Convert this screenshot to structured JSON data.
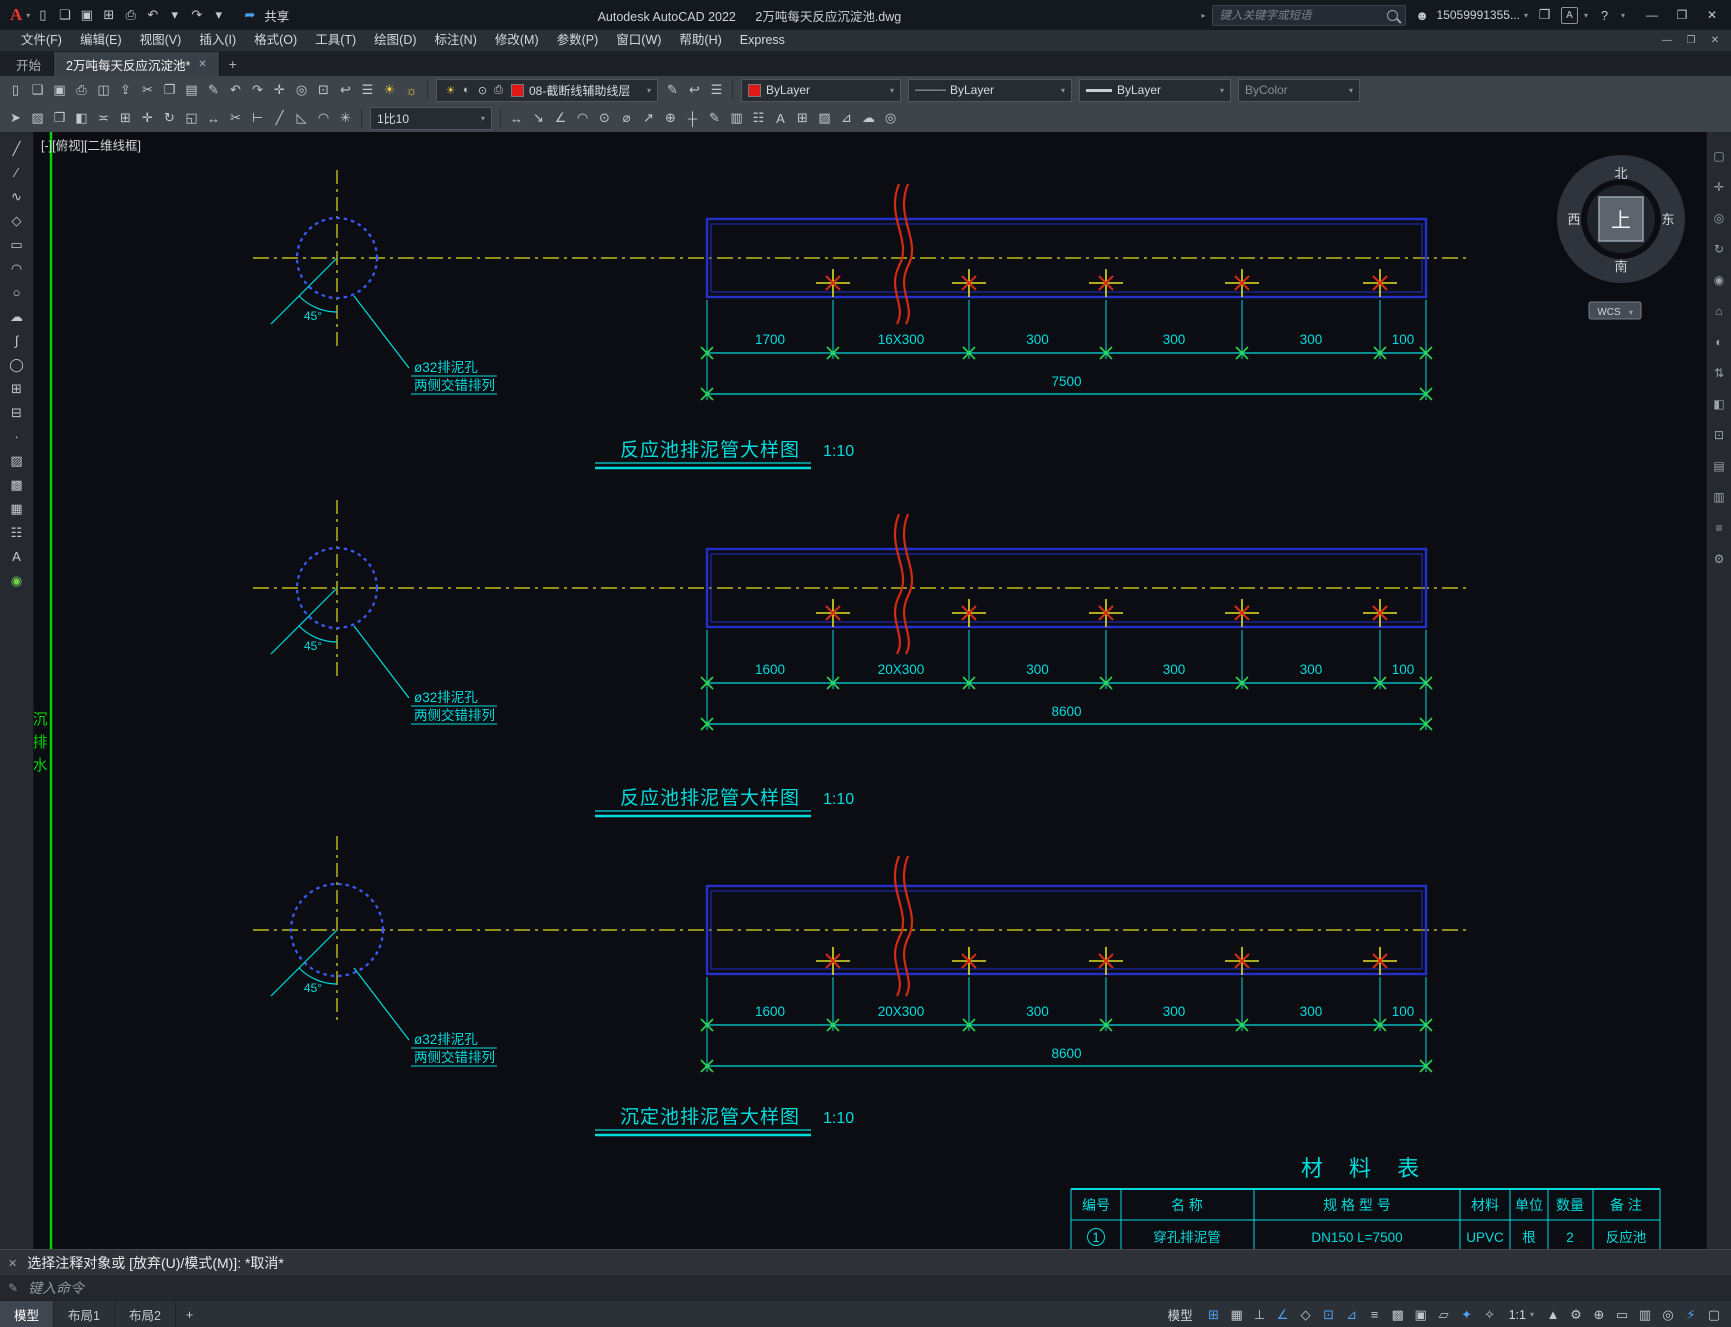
{
  "colors": {
    "cyan": "#00dcdc",
    "yellow": "#e4de1e",
    "blue": "#2330cc",
    "blue_bright": "#3d5bff",
    "red": "#d42a14",
    "green": "#00d400",
    "green2": "#2bd84e",
    "label": "#d2d6da"
  },
  "titlebar": {
    "app_title": "Autodesk AutoCAD 2022",
    "doc_title": "2万吨每天反应沉淀池.dwg",
    "share": "共享",
    "search_placeholder": "键入关键字或短语",
    "user": "15059991355...",
    "qat_icons": [
      {
        "n": "new-file",
        "g": "▯"
      },
      {
        "n": "open-file",
        "g": "❏"
      },
      {
        "n": "save",
        "g": "▣"
      },
      {
        "n": "save-as",
        "g": "⊞"
      },
      {
        "n": "plot",
        "g": "⎙"
      },
      {
        "n": "undo",
        "g": "↶"
      },
      {
        "n": "undo-caret",
        "g": "▾"
      },
      {
        "n": "redo",
        "g": "↷"
      },
      {
        "n": "redo-caret",
        "g": "▾"
      }
    ]
  },
  "menubar": {
    "items": [
      "文件(F)",
      "编辑(E)",
      "视图(V)",
      "插入(I)",
      "格式(O)",
      "工具(T)",
      "绘图(D)",
      "标注(N)",
      "修改(M)",
      "参数(P)",
      "窗口(W)",
      "帮助(H)",
      "Express"
    ]
  },
  "tabbar": {
    "start_tab": "开始",
    "doc_tab": "2万吨每天反应沉淀池*"
  },
  "toolbar1": {
    "icons_a": [
      {
        "n": "new-file",
        "g": "▯"
      },
      {
        "n": "open-file",
        "g": "❏"
      },
      {
        "n": "save",
        "g": "▣"
      },
      {
        "n": "plot",
        "g": "⎙"
      },
      {
        "n": "plot-preview",
        "g": "◫"
      },
      {
        "n": "publish",
        "g": "⇪"
      },
      {
        "n": "cut",
        "g": "✂"
      },
      {
        "n": "copy",
        "g": "❐"
      },
      {
        "n": "paste",
        "g": "▤"
      },
      {
        "n": "match-properties",
        "g": "✎"
      },
      {
        "n": "undo",
        "g": "↶"
      },
      {
        "n": "redo",
        "g": "↷"
      },
      {
        "n": "pan",
        "g": "✛"
      },
      {
        "n": "zoom-realtime",
        "g": "◎"
      },
      {
        "n": "zoom-window",
        "g": "⊡"
      },
      {
        "n": "zoom-previous",
        "g": "↩"
      },
      {
        "n": "layer-properties",
        "g": "☰"
      },
      {
        "n": "layer-on",
        "g": "☀",
        "c": "yellow"
      },
      {
        "n": "layer-freeze",
        "g": "☼",
        "c": "yellow"
      }
    ],
    "layer_status_icons": [
      {
        "n": "layer-visible",
        "g": "☀",
        "c": "yellow"
      },
      {
        "n": "layer-freeze",
        "g": "◐"
      },
      {
        "n": "layer-lock",
        "g": "⊙"
      },
      {
        "n": "layer-plot",
        "g": "⎙"
      }
    ],
    "layer_value": "08-截断线辅助线层",
    "icons_b": [
      {
        "n": "layer-match",
        "g": "✎"
      },
      {
        "n": "layer-previous",
        "g": "↩"
      },
      {
        "n": "layer-states",
        "g": "☰"
      }
    ],
    "color_value": "ByLayer",
    "linetype_value": "ByLayer",
    "lineweight_value": "ByLayer",
    "plotstyle_value": "ByColor"
  },
  "toolbar2": {
    "icons_a": [
      {
        "n": "select",
        "g": "➤"
      },
      {
        "n": "erase",
        "g": "▨"
      },
      {
        "n": "copy-object",
        "g": "❒"
      },
      {
        "n": "mirror",
        "g": "◧"
      },
      {
        "n": "offset",
        "g": "≍"
      },
      {
        "n": "array",
        "g": "⊞"
      },
      {
        "n": "move",
        "g": "✛"
      },
      {
        "n": "rotate",
        "g": "↻"
      },
      {
        "n": "scale",
        "g": "◱"
      },
      {
        "n": "stretch",
        "g": "↔"
      },
      {
        "n": "trim",
        "g": "✂"
      },
      {
        "n": "extend",
        "g": "⊢"
      },
      {
        "n": "break",
        "g": "╱"
      },
      {
        "n": "chamfer",
        "g": "◺"
      },
      {
        "n": "fillet",
        "g": "◠"
      },
      {
        "n": "explode",
        "g": "✳"
      }
    ],
    "scale_value": "1比10",
    "icons_b": [
      {
        "n": "dim-linear",
        "g": "↔"
      },
      {
        "n": "dim-aligned",
        "g": "↘"
      },
      {
        "n": "dim-angular",
        "g": "∠"
      },
      {
        "n": "dim-arc",
        "g": "◠"
      },
      {
        "n": "dim-radius",
        "g": "⊙"
      },
      {
        "n": "dim-diameter",
        "g": "⌀"
      },
      {
        "n": "leader",
        "g": "↗"
      },
      {
        "n": "tolerance",
        "g": "⊕"
      },
      {
        "n": "center-mark",
        "g": "┼"
      },
      {
        "n": "dim-edit",
        "g": "✎"
      },
      {
        "n": "dim-style",
        "g": "▥"
      },
      {
        "n": "table",
        "g": "☷"
      },
      {
        "n": "mtext",
        "g": "A"
      },
      {
        "n": "block",
        "g": "⊞"
      },
      {
        "n": "hatch",
        "g": "▨"
      },
      {
        "n": "measure",
        "g": "⊿"
      },
      {
        "n": "revision-cloud",
        "g": "☁"
      },
      {
        "n": "osnap-settings",
        "g": "◎"
      }
    ]
  },
  "left_toolbar": {
    "icons": [
      {
        "n": "line",
        "g": "╱"
      },
      {
        "n": "construction-line",
        "g": "∕"
      },
      {
        "n": "polyline",
        "g": "∿"
      },
      {
        "n": "polygon",
        "g": "◇"
      },
      {
        "n": "rectangle",
        "g": "▭"
      },
      {
        "n": "arc",
        "g": "◠"
      },
      {
        "n": "circle",
        "g": "○"
      },
      {
        "n": "revision-cloud",
        "g": "☁"
      },
      {
        "n": "spline",
        "g": "∫"
      },
      {
        "n": "ellipse",
        "g": "◯"
      },
      {
        "n": "insert-block",
        "g": "⊞"
      },
      {
        "n": "create-block",
        "g": "⊟"
      },
      {
        "n": "point",
        "g": "∙"
      },
      {
        "n": "hatch",
        "g": "▨"
      },
      {
        "n": "gradient",
        "g": "▩"
      },
      {
        "n": "region",
        "g": "▦"
      },
      {
        "n": "table",
        "g": "☷"
      },
      {
        "n": "text",
        "g": "A"
      },
      {
        "n": "color-ball",
        "g": "◉",
        "c": "green"
      }
    ]
  },
  "right_toolbar": {
    "icons": [
      {
        "n": "fullscreen",
        "g": "▢"
      },
      {
        "n": "pan",
        "g": "✛"
      },
      {
        "n": "zoom",
        "g": "◎"
      },
      {
        "n": "orbit",
        "g": "↻"
      },
      {
        "n": "steering-wheel",
        "g": "◉"
      },
      {
        "n": "home-view",
        "g": "⌂"
      },
      {
        "n": "look",
        "g": "◐"
      },
      {
        "n": "walk",
        "g": "⇅"
      },
      {
        "n": "section",
        "g": "◧"
      },
      {
        "n": "object-snap",
        "g": "⊡"
      },
      {
        "n": "layers-panel",
        "g": "▤"
      },
      {
        "n": "properties-panel",
        "g": "▥"
      },
      {
        "n": "list",
        "g": "≡"
      },
      {
        "n": "settings",
        "g": "⚙"
      }
    ]
  },
  "canvas": {
    "viewport_label": "[-][俯视][二维线框]",
    "left_margin_text": [
      "沉",
      "排",
      "水"
    ],
    "compass": {
      "north": "北",
      "south": "南",
      "east": "东",
      "west": "西",
      "top": "上",
      "wcs": "WCS"
    }
  },
  "drawings": [
    {
      "title": "反应池排泥管大样图",
      "scale": "1:10",
      "angle_label": "45°",
      "note_lines": [
        "ø32排泥孔",
        "两侧交错排列"
      ],
      "dims": [
        "1700",
        "16X300",
        "300",
        "300",
        "300",
        "100"
      ],
      "total": "7500"
    },
    {
      "title": "反应池排泥管大样图",
      "scale": "1:10",
      "angle_label": "45°",
      "note_lines": [
        "ø32排泥孔",
        "两侧交错排列"
      ],
      "dims": [
        "1600",
        "20X300",
        "300",
        "300",
        "300",
        "100"
      ],
      "total": "8600"
    },
    {
      "title": "沉定池排泥管大样图",
      "scale": "1:10",
      "angle_label": "45°",
      "note_lines": [
        "ø32排泥孔",
        "两侧交错排列"
      ],
      "dims": [
        "1600",
        "20X300",
        "300",
        "300",
        "300",
        "100"
      ],
      "total": "8600"
    }
  ],
  "material_table": {
    "title": "材 料 表",
    "headers": [
      "编号",
      "名  称",
      "规 格 型 号",
      "材料",
      "单位",
      "数量",
      "备 注"
    ],
    "rows": [
      [
        "1",
        "穿孔排泥管",
        "DN150  L=7500",
        "UPVC",
        "根",
        "2",
        "反应池"
      ]
    ]
  },
  "commandline": {
    "history": "选择注释对象或 [放弃(U)/模式(M)]: *取消*",
    "prompt": "键入命令"
  },
  "statusbar": {
    "layout_tabs": [
      "模型",
      "布局1",
      "布局2"
    ],
    "model_label": "模型",
    "annotation_scale": "1:1",
    "icons_a": [
      {
        "n": "grid",
        "g": "⊞",
        "c": "blue"
      },
      {
        "n": "snap-mode",
        "g": "▦"
      },
      {
        "n": "ortho",
        "g": "⊥"
      },
      {
        "n": "polar-tracking",
        "g": "∠",
        "c": "blue"
      },
      {
        "n": "isodraft",
        "g": "◇"
      },
      {
        "n": "object-snap",
        "g": "⊡",
        "c": "blue"
      },
      {
        "n": "snap-tracking",
        "g": "⊿",
        "c": "blue"
      },
      {
        "n": "lineweight-display",
        "g": "≡"
      },
      {
        "n": "transparency",
        "g": "▩"
      },
      {
        "n": "selection-cycling",
        "g": "▣"
      },
      {
        "n": "dynamic-ucs",
        "g": "▱"
      },
      {
        "n": "annotation-visibility",
        "g": "✦",
        "c": "blue"
      },
      {
        "n": "autoscale",
        "g": "✧"
      }
    ],
    "icons_b": [
      {
        "n": "annotation-switch",
        "g": "▲"
      },
      {
        "n": "workspace-settings",
        "g": "⚙"
      },
      {
        "n": "annotation-monitor",
        "g": "⊕"
      },
      {
        "n": "units",
        "g": "▭"
      },
      {
        "n": "quick-properties",
        "g": "▥"
      },
      {
        "n": "isolate-objects",
        "g": "◎"
      },
      {
        "n": "graphics-performance",
        "g": "⚡",
        "c": "blue"
      },
      {
        "n": "clean-screen",
        "g": "▢"
      }
    ]
  }
}
